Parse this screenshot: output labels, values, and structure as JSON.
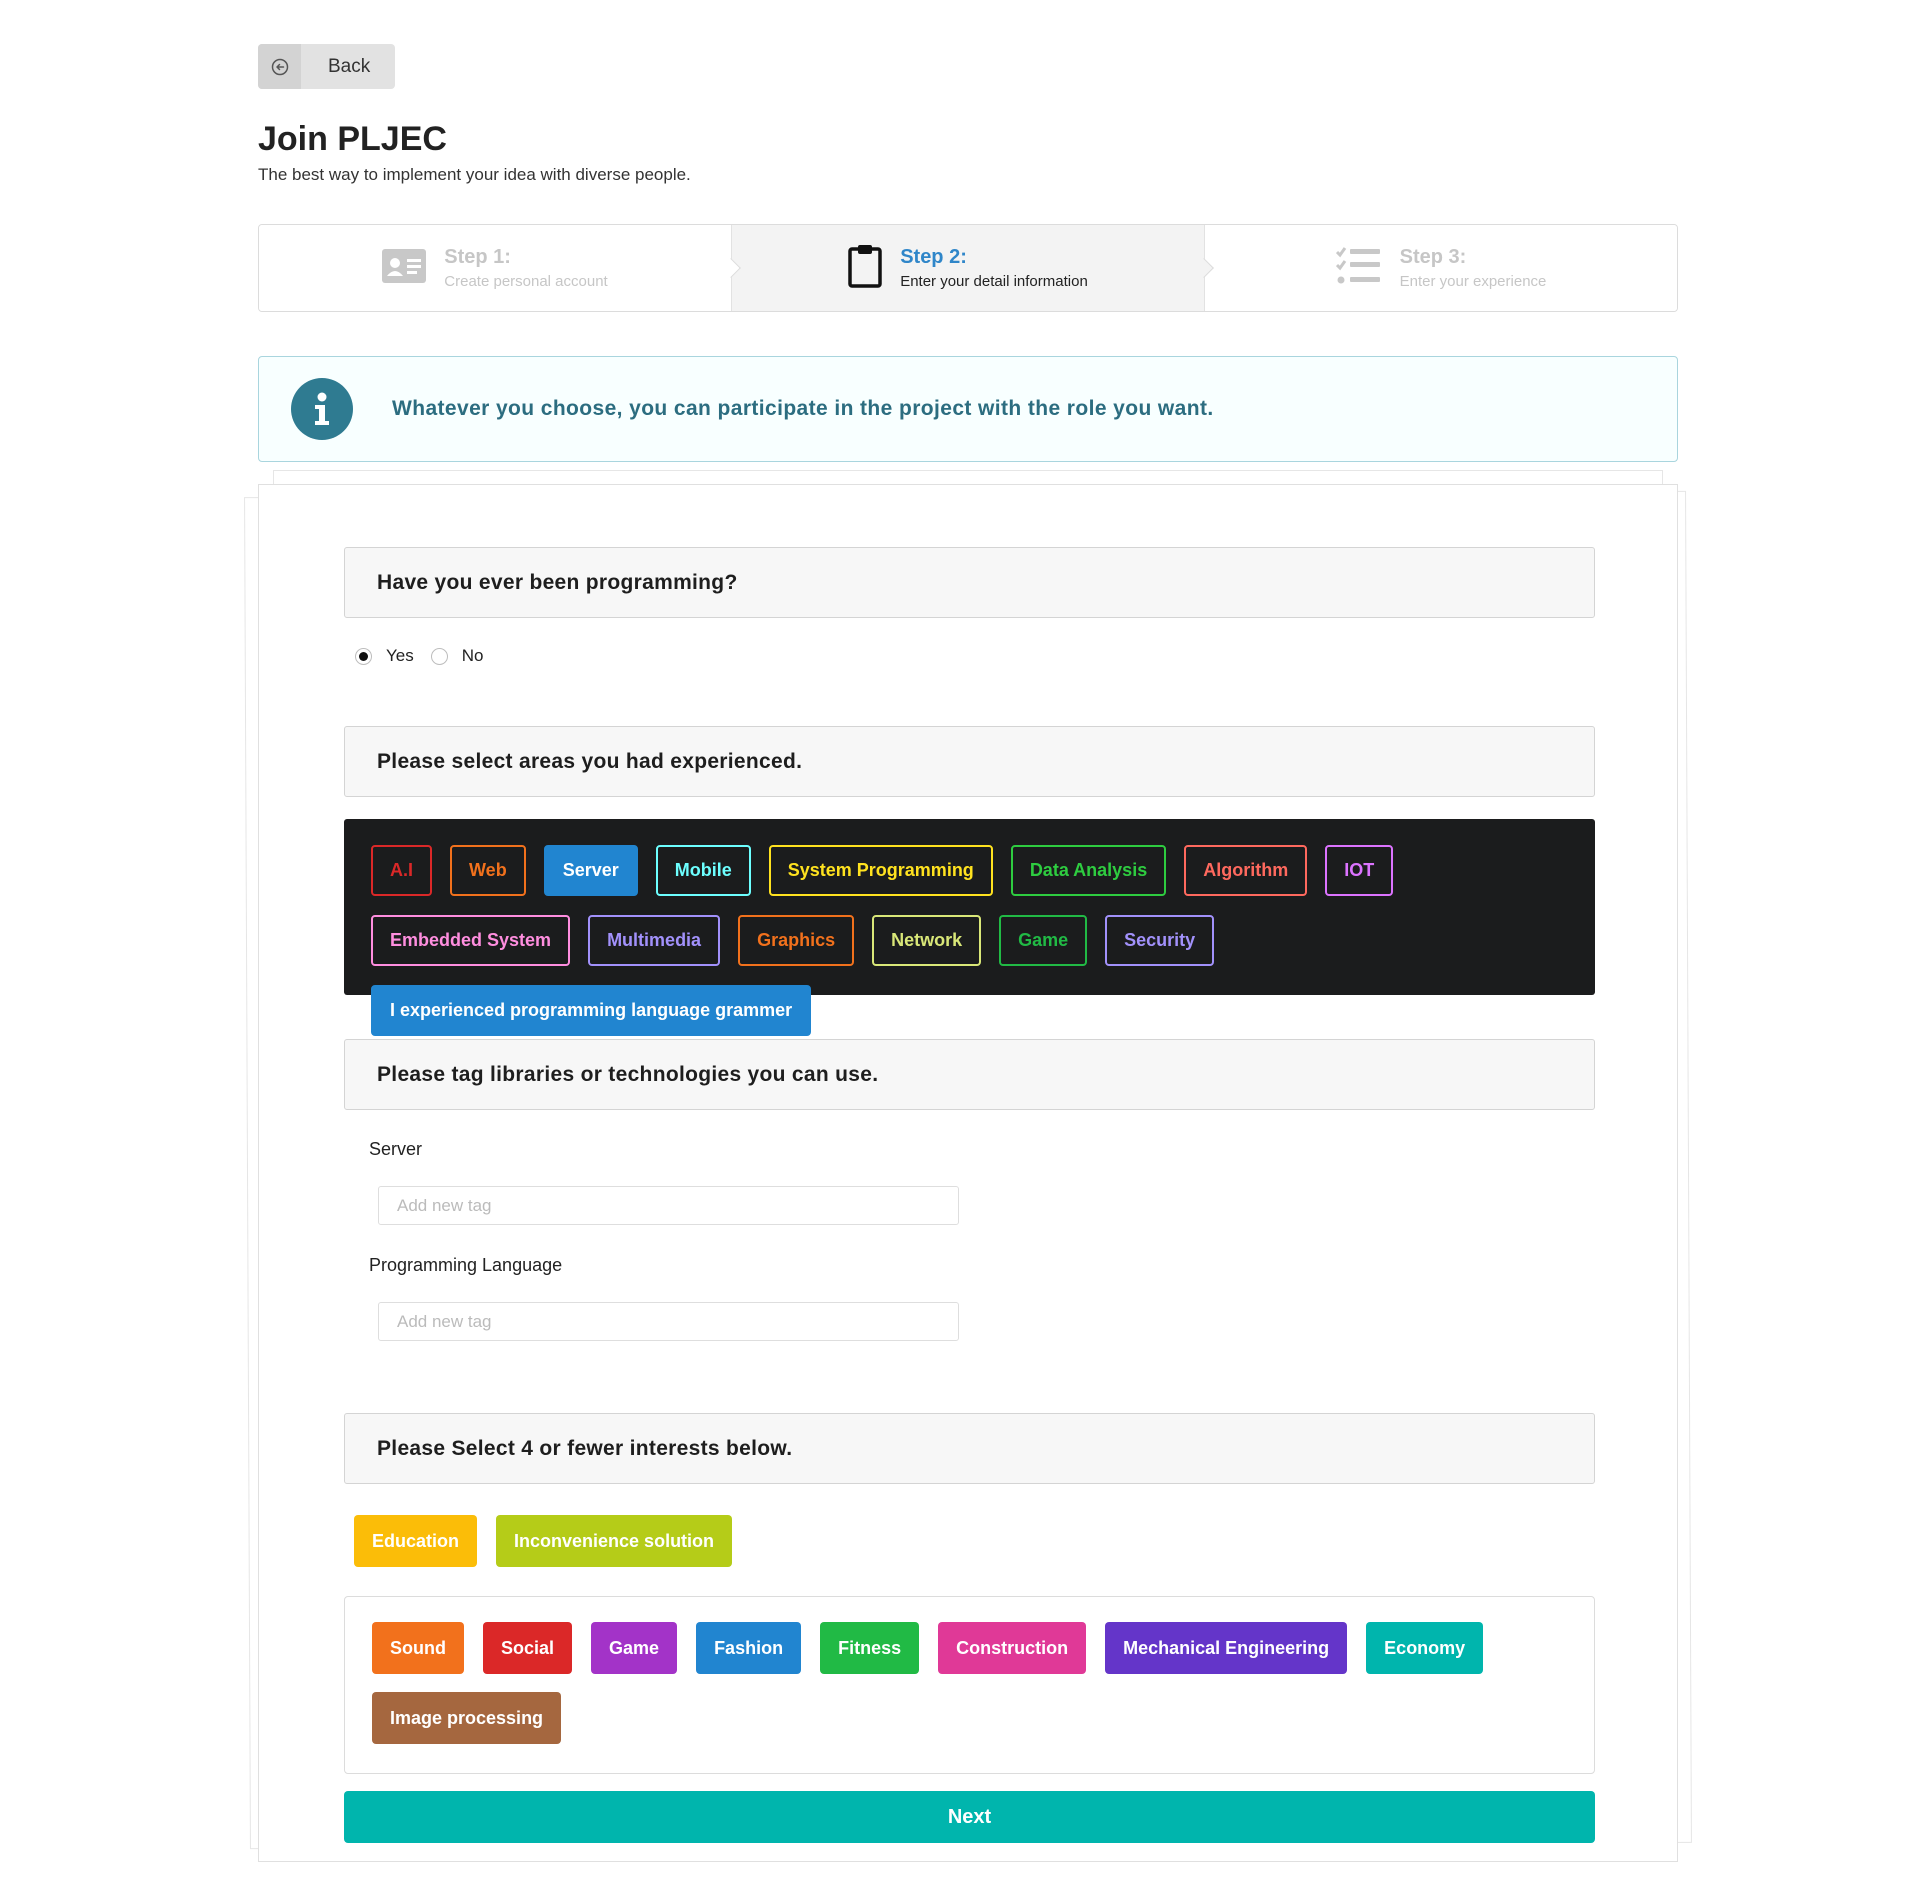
{
  "back": {
    "label": "Back",
    "icon": "circle-arrow-left-icon"
  },
  "header": {
    "title": "Join PLJEC",
    "subtitle": "The best way to implement your idea with diverse people."
  },
  "steps": [
    {
      "title": "Step 1:",
      "desc": "Create personal account",
      "icon": "id-card-icon",
      "state": "inactive"
    },
    {
      "title": "Step 2:",
      "desc": "Enter your detail information",
      "icon": "clipboard-icon",
      "state": "active"
    },
    {
      "title": "Step 3:",
      "desc": "Enter your experience",
      "icon": "tasks-icon",
      "state": "inactive"
    }
  ],
  "info": {
    "text": "Whatever you choose, you can participate in the project with the role you want.",
    "icon": "info-icon"
  },
  "programming": {
    "question": "Have you ever been programming?",
    "options": [
      {
        "label": "Yes",
        "checked": true
      },
      {
        "label": "No",
        "checked": false
      }
    ]
  },
  "areas": {
    "question": "Please select areas you had experienced.",
    "tags": [
      {
        "label": "A.I",
        "color": "#db2828",
        "selected": false
      },
      {
        "label": "Web",
        "color": "#f2711c",
        "selected": false
      },
      {
        "label": "Server",
        "color": "#2185d0",
        "selected": true
      },
      {
        "label": "Mobile",
        "color": "#6dffff",
        "selected": false
      },
      {
        "label": "System Programming",
        "color": "#ffe21f",
        "selected": false
      },
      {
        "label": "Data Analysis",
        "color": "#2ecc40",
        "selected": false
      },
      {
        "label": "Algorithm",
        "color": "#ff695e",
        "selected": false
      },
      {
        "label": "IOT",
        "color": "#dc73ff",
        "selected": false
      },
      {
        "label": "Embedded System",
        "color": "#ff8edf",
        "selected": false
      },
      {
        "label": "Multimedia",
        "color": "#a291fb",
        "selected": false
      },
      {
        "label": "Graphics",
        "color": "#f2711c",
        "selected": false
      },
      {
        "label": "Network",
        "color": "#d9e778",
        "selected": false
      },
      {
        "label": "Game",
        "color": "#21ba45",
        "selected": false
      },
      {
        "label": "Security",
        "color": "#a291fb",
        "selected": false
      },
      {
        "label": "I experienced programming language grammer",
        "color": "#2185d0",
        "selected": true
      }
    ]
  },
  "libraries": {
    "question": "Please tag libraries or technologies you can use.",
    "fields": [
      {
        "label": "Server",
        "placeholder": "Add new tag"
      },
      {
        "label": "Programming Language",
        "placeholder": "Add new tag"
      }
    ]
  },
  "interests": {
    "question": "Please Select 4 or fewer interests below.",
    "selected": [
      {
        "label": "Education",
        "color": "#fbbd08"
      },
      {
        "label": "Inconvenience solution",
        "color": "#b5cc18"
      }
    ],
    "available": [
      {
        "label": "Sound",
        "color": "#f2711c"
      },
      {
        "label": "Social",
        "color": "#db2828"
      },
      {
        "label": "Game",
        "color": "#a333c8"
      },
      {
        "label": "Fashion",
        "color": "#2185d0"
      },
      {
        "label": "Fitness",
        "color": "#21ba45"
      },
      {
        "label": "Construction",
        "color": "#e03997"
      },
      {
        "label": "Mechanical Engineering",
        "color": "#6435c9"
      },
      {
        "label": "Economy",
        "color": "#00b5ad"
      },
      {
        "label": "Image processing",
        "color": "#a5673f"
      }
    ]
  },
  "next": {
    "label": "Next",
    "color": "#00b5ad"
  }
}
